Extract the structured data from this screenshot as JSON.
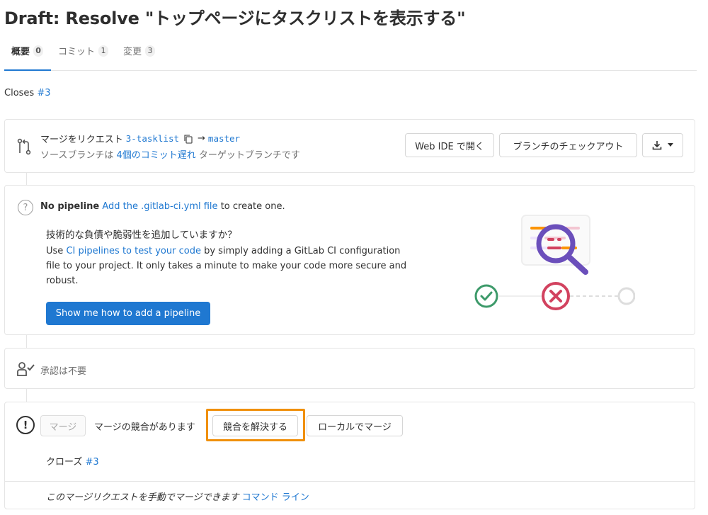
{
  "title": "Draft: Resolve \"トップページにタスクリストを表示する\"",
  "tabs": [
    {
      "label": "概要",
      "count": "0"
    },
    {
      "label": "コミット",
      "count": "1"
    },
    {
      "label": "変更",
      "count": "3"
    }
  ],
  "description": {
    "closes_label": "Closes",
    "closes_issue": "#3"
  },
  "merge_request": {
    "prefix": "マージをリクエスト",
    "source_branch": "3-tasklist",
    "arrow": "→",
    "target_branch": "master",
    "status_prefix": "ソースブランチは",
    "behind_link": "4個のコミット遅れ",
    "status_suffix": "ターゲットブランチです",
    "web_ide_button": "Web IDE で開く",
    "checkout_button": "ブランチのチェックアウト"
  },
  "pipeline": {
    "no_pipeline": "No pipeline",
    "add_link": "Add the .gitlab-ci.yml file",
    "add_suffix": "to create one.",
    "heading": "技術的な負債や脆弱性を追加していますか？",
    "desc_prefix": "Use",
    "desc_link": "CI pipelines to test your code",
    "desc_rest": "by simply adding a GitLab CI configuration file to your project. It only takes a minute to make your code more secure and robust.",
    "button": "Show me how to add a pipeline"
  },
  "approval": {
    "text": "承認は不要"
  },
  "merge": {
    "merge_button": "マージ",
    "conflict_text": "マージの競合があります",
    "resolve_button": "競合を解決する",
    "local_merge_button": "ローカルでマージ",
    "close_label": "クローズ",
    "close_issue": "#3",
    "manual_text": "このマージリクエストを手動でマージできます",
    "command_line_link": "コマンド ライン"
  },
  "colors": {
    "link": "#1f78d1",
    "primary_button": "#1f78d1",
    "highlight": "#f0900c",
    "success": "#3d9a6a",
    "failed": "#d2425f",
    "illustration_purple": "#6b4fbb"
  },
  "icons": [
    "merge-request-icon",
    "copy-icon",
    "download-icon",
    "chevron-down-icon",
    "question-icon",
    "approval-icon",
    "warning-icon",
    "magnifier-icon",
    "check-icon",
    "x-icon"
  ]
}
